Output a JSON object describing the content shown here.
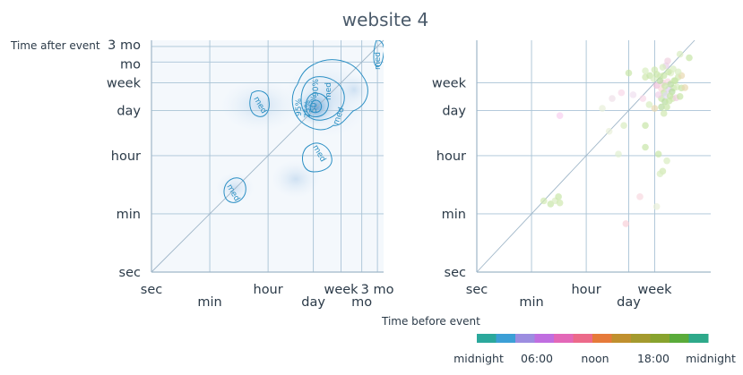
{
  "title": "website 4",
  "ylabel": "Time after event",
  "xlabel": "Time before event",
  "colors": {
    "grid": "#a9c3d6",
    "axis": "#9fb6c8",
    "contour": "#2b8fc4",
    "panel_bg": "#f4f8fc"
  },
  "chart_data": [
    {
      "type": "heatmap",
      "scale": "log",
      "x_ticks": [
        {
          "value": 1,
          "label": "sec"
        },
        {
          "value": 60,
          "label": "min"
        },
        {
          "value": 3600,
          "label": "hour"
        },
        {
          "value": 86400,
          "label": "day"
        },
        {
          "value": 604800,
          "label": "week"
        },
        {
          "value": 2592000,
          "label": "mo"
        },
        {
          "value": 7776000,
          "label": "3 mo"
        }
      ],
      "y_ticks": [
        {
          "value": 1,
          "label": "sec"
        },
        {
          "value": 60,
          "label": "min"
        },
        {
          "value": 3600,
          "label": "hour"
        },
        {
          "value": 86400,
          "label": "day"
        },
        {
          "value": 604800,
          "label": "week"
        },
        {
          "value": 2592000,
          "label": "mo"
        },
        {
          "value": 7776000,
          "label": "3 mo"
        }
      ],
      "xlim": [
        1,
        12000000
      ],
      "ylim": [
        1,
        12000000
      ],
      "contour_labels": [
        "med",
        "med",
        "med",
        "med",
        "med",
        "med",
        "95%",
        "90%",
        "75%",
        "50%"
      ],
      "diagonal": true
    },
    {
      "type": "scatter",
      "scale": "log",
      "x_ticks": [
        {
          "value": 1,
          "label": "sec"
        },
        {
          "value": 60,
          "label": "min"
        },
        {
          "value": 3600,
          "label": "hour"
        },
        {
          "value": 86400,
          "label": "day"
        },
        {
          "value": 604800,
          "label": "week"
        }
      ],
      "y_ticks": [
        {
          "value": 1,
          "label": "sec"
        },
        {
          "value": 60,
          "label": "min"
        },
        {
          "value": 3600,
          "label": "hour"
        },
        {
          "value": 86400,
          "label": "day"
        },
        {
          "value": 604800,
          "label": "week"
        }
      ],
      "xlim": [
        1,
        40000000
      ],
      "ylim": [
        1,
        12000000
      ],
      "diagonal": true,
      "points": [
        {
          "x": 86400,
          "y": 1200000,
          "c": "#c8e6a8"
        },
        {
          "x": 300000,
          "y": 1400000,
          "c": "#d8eec0"
        },
        {
          "x": 1400000,
          "y": 2000000,
          "c": "#e8d0e8"
        },
        {
          "x": 4000000,
          "y": 4500000,
          "c": "#d8ecc0"
        },
        {
          "x": 8000000,
          "y": 3500000,
          "c": "#c8e6a8"
        },
        {
          "x": 1600000,
          "y": 2800000,
          "c": "#f0d0e0"
        },
        {
          "x": 300000,
          "y": 900000,
          "c": "#d0e8b0"
        },
        {
          "x": 420000,
          "y": 1000000,
          "c": "#c8e6a8"
        },
        {
          "x": 560000,
          "y": 800000,
          "c": "#d8ecc0"
        },
        {
          "x": 700000,
          "y": 1100000,
          "c": "#c8e6a8"
        },
        {
          "x": 900000,
          "y": 950000,
          "c": "#d0e8b0"
        },
        {
          "x": 1200000,
          "y": 1000000,
          "c": "#c8e6a8"
        },
        {
          "x": 2000000,
          "y": 1200000,
          "c": "#e0f0c8"
        },
        {
          "x": 2800000,
          "y": 700000,
          "c": "#c8e6a8"
        },
        {
          "x": 3500000,
          "y": 900000,
          "c": "#d0e8b0"
        },
        {
          "x": 4500000,
          "y": 1000000,
          "c": "#e8d8b0"
        },
        {
          "x": 2500000,
          "y": 420000,
          "c": "#c8e6a8"
        },
        {
          "x": 3200000,
          "y": 450000,
          "c": "#d8ecc0"
        },
        {
          "x": 4500000,
          "y": 420000,
          "c": "#c8e6a8"
        },
        {
          "x": 5800000,
          "y": 430000,
          "c": "#e8d8b0"
        },
        {
          "x": 1000000,
          "y": 400000,
          "c": "#f8d8d8"
        },
        {
          "x": 1200000,
          "y": 300000,
          "c": "#c8e6a8"
        },
        {
          "x": 1700000,
          "y": 380000,
          "c": "#e0d0f0"
        },
        {
          "x": 2200000,
          "y": 320000,
          "c": "#b8dca0"
        },
        {
          "x": 1000000,
          "y": 200000,
          "c": "#c8e6a8"
        },
        {
          "x": 1300000,
          "y": 160000,
          "c": "#b8dca0"
        },
        {
          "x": 1800000,
          "y": 170000,
          "c": "#c8e6a8"
        },
        {
          "x": 2300000,
          "y": 200000,
          "c": "#d0e8b0"
        },
        {
          "x": 3000000,
          "y": 210000,
          "c": "#f0d0e0"
        },
        {
          "x": 4000000,
          "y": 230000,
          "c": "#c8e6a8"
        },
        {
          "x": 1000000,
          "y": 110000,
          "c": "#b8dca0"
        },
        {
          "x": 1500000,
          "y": 110000,
          "c": "#c8e6a8"
        },
        {
          "x": 1200000,
          "y": 70000,
          "c": "#d0e8b0"
        },
        {
          "x": 600000,
          "y": 100000,
          "c": "#e8d8b0"
        },
        {
          "x": 400000,
          "y": 130000,
          "c": "#d8ecc0"
        },
        {
          "x": 250000,
          "y": 200000,
          "c": "#f8d8e8"
        },
        {
          "x": 120000,
          "y": 260000,
          "c": "#f0e0f0"
        },
        {
          "x": 50000,
          "y": 300000,
          "c": "#f8d8e8"
        },
        {
          "x": 25000,
          "y": 200000,
          "c": "#f0e0e8"
        },
        {
          "x": 12000,
          "y": 100000,
          "c": "#e8f0d8"
        },
        {
          "x": 500,
          "y": 60000,
          "c": "#f8d0f0"
        },
        {
          "x": 800000,
          "y": 4000,
          "c": "#c8e6a8"
        },
        {
          "x": 1100000,
          "y": 1200,
          "c": "#d0e8b0"
        },
        {
          "x": 1500000,
          "y": 2500,
          "c": "#d8ecc0"
        },
        {
          "x": 300000,
          "y": 6500,
          "c": "#c8e6a8"
        },
        {
          "x": 40000,
          "y": 4000,
          "c": "#e0f0d0"
        },
        {
          "x": 20000,
          "y": 20000,
          "c": "#e8f0d8"
        },
        {
          "x": 60000,
          "y": 30000,
          "c": "#d8ecc0"
        },
        {
          "x": 300000,
          "y": 30000,
          "c": "#c8e6a8"
        },
        {
          "x": 200000,
          "y": 200,
          "c": "#f8d8e0"
        },
        {
          "x": 700000,
          "y": 100,
          "c": "#e8f0d8"
        },
        {
          "x": 900000,
          "y": 1000,
          "c": "#d8ecc0"
        },
        {
          "x": 70000,
          "y": 30,
          "c": "#f8d0d8"
        },
        {
          "x": 150,
          "y": 150,
          "c": "#d0e8b0"
        },
        {
          "x": 250,
          "y": 120,
          "c": "#c8e6a8"
        },
        {
          "x": 350,
          "y": 150,
          "c": "#d8ecc0"
        },
        {
          "x": 450,
          "y": 200,
          "c": "#c8e6a8"
        },
        {
          "x": 500,
          "y": 130,
          "c": "#d0e8b0"
        },
        {
          "x": 700000,
          "y": 500000,
          "c": "#f0c0d8"
        },
        {
          "x": 1100000,
          "y": 600000,
          "c": "#f8d0e0"
        },
        {
          "x": 1600000,
          "y": 650000,
          "c": "#f8d8e0"
        },
        {
          "x": 2000000,
          "y": 550000,
          "c": "#b8dca0"
        },
        {
          "x": 2600000,
          "y": 700000,
          "c": "#c8e6a8"
        },
        {
          "x": 800000,
          "y": 260000,
          "c": "#f0d0e8"
        },
        {
          "x": 1400000,
          "y": 250000,
          "c": "#e0d8f0"
        },
        {
          "x": 1900000,
          "y": 240000,
          "c": "#c8e6a8"
        },
        {
          "x": 600000,
          "y": 1500000,
          "c": "#d0e8b0"
        },
        {
          "x": 1100000,
          "y": 1800000,
          "c": "#d8ecc0"
        },
        {
          "x": 1700000,
          "y": 1300000,
          "c": "#c8e6a8"
        },
        {
          "x": 2400000,
          "y": 1600000,
          "c": "#d8ecc0"
        },
        {
          "x": 900000,
          "y": 700000,
          "c": "#b8dca0"
        },
        {
          "x": 1300000,
          "y": 480000,
          "c": "#c8e6a8"
        },
        {
          "x": 3500000,
          "y": 1300000,
          "c": "#d8ecc0"
        }
      ]
    }
  ],
  "colorbar": {
    "labels": [
      "midnight",
      "06:00",
      "noon",
      "18:00",
      "midnight"
    ],
    "segments": [
      "#2ba89c",
      "#3c9fd6",
      "#9c8de0",
      "#c06ee0",
      "#e368b8",
      "#ec6a8a",
      "#e67a3a",
      "#c0902e",
      "#a49a2e",
      "#88a32e",
      "#5aab3a",
      "#2ea98a"
    ]
  }
}
